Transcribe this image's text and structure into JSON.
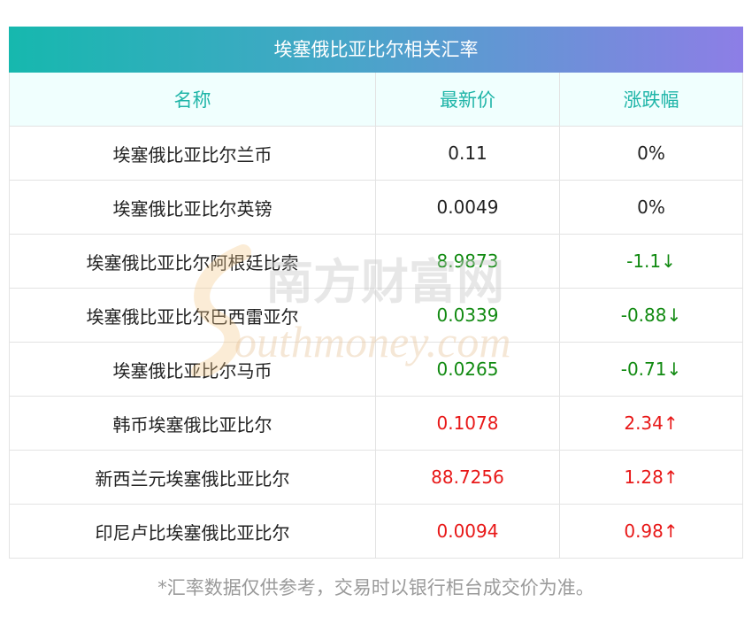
{
  "title": "埃塞俄比亚比尔相关汇率",
  "headers": [
    "名称",
    "最新价",
    "涨跌幅"
  ],
  "rows": [
    {
      "name": "埃塞俄比亚比尔兰币",
      "price": "0.11",
      "change": "0%",
      "trend": "flat"
    },
    {
      "name": "埃塞俄比亚比尔英镑",
      "price": "0.0049",
      "change": "0%",
      "trend": "flat"
    },
    {
      "name": "埃塞俄比亚比尔阿根廷比索",
      "price": "8.9873",
      "change": "-1.1↓",
      "trend": "down"
    },
    {
      "name": "埃塞俄比亚比尔巴西雷亚尔",
      "price": "0.0339",
      "change": "-0.88↓",
      "trend": "down"
    },
    {
      "name": "埃塞俄比亚比尔马币",
      "price": "0.0265",
      "change": "-0.71↓",
      "trend": "down"
    },
    {
      "name": "韩币埃塞俄比亚比尔",
      "price": "0.1078",
      "change": "2.34↑",
      "trend": "up"
    },
    {
      "name": "新西兰元埃塞俄比亚比尔",
      "price": "88.7256",
      "change": "1.28↑",
      "trend": "up"
    },
    {
      "name": "印尼卢比埃塞俄比亚比尔",
      "price": "0.0094",
      "change": "0.98↑",
      "trend": "up"
    }
  ],
  "footnote": "*汇率数据仅供参考，交易时以银行柜台成交价为准。",
  "watermark": {
    "cn": "南方财富网",
    "en": "outhmoney.com"
  },
  "colors": {
    "up": "#e81818",
    "down": "#118a11",
    "header_text": "#1fb5a8"
  }
}
